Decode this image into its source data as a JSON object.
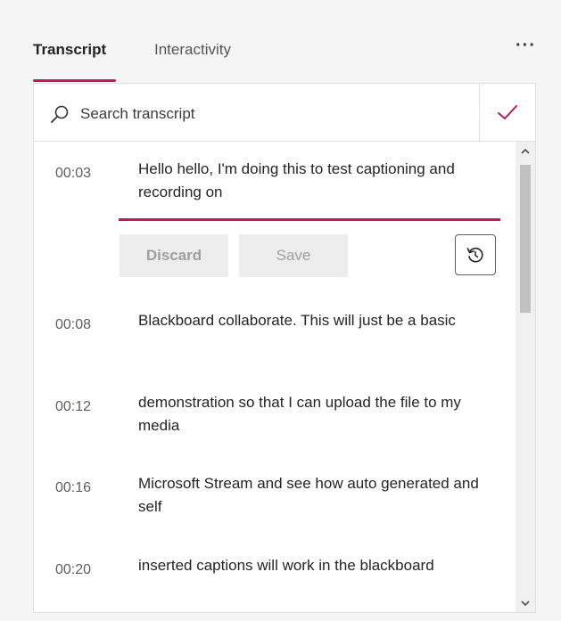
{
  "tabs": [
    {
      "label": "Transcript",
      "active": true
    },
    {
      "label": "Interactivity",
      "active": false
    }
  ],
  "more_icon": "more-horizontal-icon",
  "search": {
    "placeholder": "Search transcript",
    "value": ""
  },
  "accent_color": "#c2185b",
  "editing": {
    "time": "00:03",
    "text": "Hello hello, I'm doing this to test captioning and recording on",
    "discard_label": "Discard",
    "save_label": "Save"
  },
  "entries": [
    {
      "time": "00:08",
      "text": "Blackboard collaborate. This will just be a basic"
    },
    {
      "time": "00:12",
      "text": "demonstration so that I can upload the file to my media"
    },
    {
      "time": "00:16",
      "text": "Microsoft Stream and see how auto generated and self"
    },
    {
      "time": "00:20",
      "text": "inserted captions will work in the blackboard"
    }
  ]
}
